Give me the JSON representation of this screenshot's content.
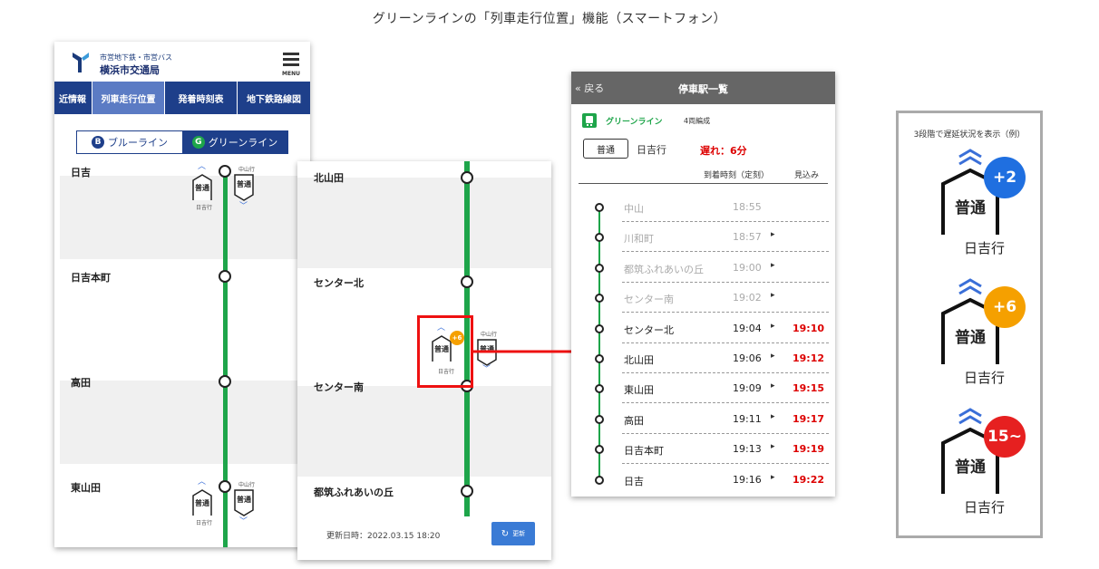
{
  "page_title": "グリーンラインの「列車走行位置」機能（スマートフォン）",
  "phone1": {
    "logo_sub": "市営地下鉄・市営バス",
    "logo_main": "横浜市交通局",
    "menu_label": "MENU",
    "tabs": [
      {
        "label": "近情報"
      },
      {
        "label": "列車走行位置"
      },
      {
        "label": "発着時刻表"
      },
      {
        "label": "地下鉄路線図"
      }
    ],
    "line_blue": "ブルーライン",
    "line_blue_badge": "B",
    "line_green": "グリーンライン",
    "line_green_badge": "G",
    "stations": [
      {
        "name": "日吉"
      },
      {
        "name": "日吉本町"
      },
      {
        "name": "高田"
      },
      {
        "name": "東山田"
      }
    ],
    "train_type": "普通",
    "dest_up": "日吉行",
    "dest_down": "中山行"
  },
  "phone2": {
    "stations": [
      {
        "name": "北山田"
      },
      {
        "name": "センター北"
      },
      {
        "name": "センター南"
      },
      {
        "name": "都筑ふれあいの丘"
      }
    ],
    "train_type": "普通",
    "train_badge": "+6",
    "dest_up": "日吉行",
    "dest_down": "中山行",
    "update_text": "更新日時：2022.03.15 18:20",
    "update_btn": "更新"
  },
  "phone3": {
    "back": "戻る",
    "title": "停車駅一覧",
    "line_name": "グリーンライン",
    "cars": "4両編成",
    "train_type": "普通",
    "dest": "日吉行",
    "delay": "遅れ：6分",
    "col_arrival": "到着時刻（定刻）",
    "col_expected": "見込み",
    "rows": [
      {
        "station": "中山",
        "time": "18:55",
        "expected": "",
        "arrow": ""
      },
      {
        "station": "川和町",
        "time": "18:57",
        "expected": "",
        "arrow": "▸"
      },
      {
        "station": "都筑ふれあいの丘",
        "time": "19:00",
        "expected": "",
        "arrow": "▸"
      },
      {
        "station": "センター南",
        "time": "19:02",
        "expected": "",
        "arrow": "▸"
      },
      {
        "station": "センター北",
        "time": "19:04",
        "expected": "19:10",
        "arrow": "▸"
      },
      {
        "station": "北山田",
        "time": "19:06",
        "expected": "19:12",
        "arrow": "▸"
      },
      {
        "station": "東山田",
        "time": "19:09",
        "expected": "19:15",
        "arrow": "▸"
      },
      {
        "station": "高田",
        "time": "19:11",
        "expected": "19:17",
        "arrow": "▸"
      },
      {
        "station": "日吉本町",
        "time": "19:13",
        "expected": "19:19",
        "arrow": "▸"
      },
      {
        "station": "日吉",
        "time": "19:16",
        "expected": "19:22",
        "arrow": "▸"
      }
    ]
  },
  "legend": {
    "title": "3段階で遅延状況を表示（例）",
    "items": [
      {
        "type": "普通",
        "badge": "+2",
        "dest": "日吉行",
        "color": "#1f6fe0"
      },
      {
        "type": "普通",
        "badge": "+6",
        "dest": "日吉行",
        "color": "#f5a000"
      },
      {
        "type": "普通",
        "badge": "15~",
        "dest": "日吉行",
        "color": "#e62020"
      }
    ]
  },
  "colors": {
    "green_line": "#1ea54a",
    "navy": "#1e3f8a",
    "delay_red": "#d00000"
  }
}
